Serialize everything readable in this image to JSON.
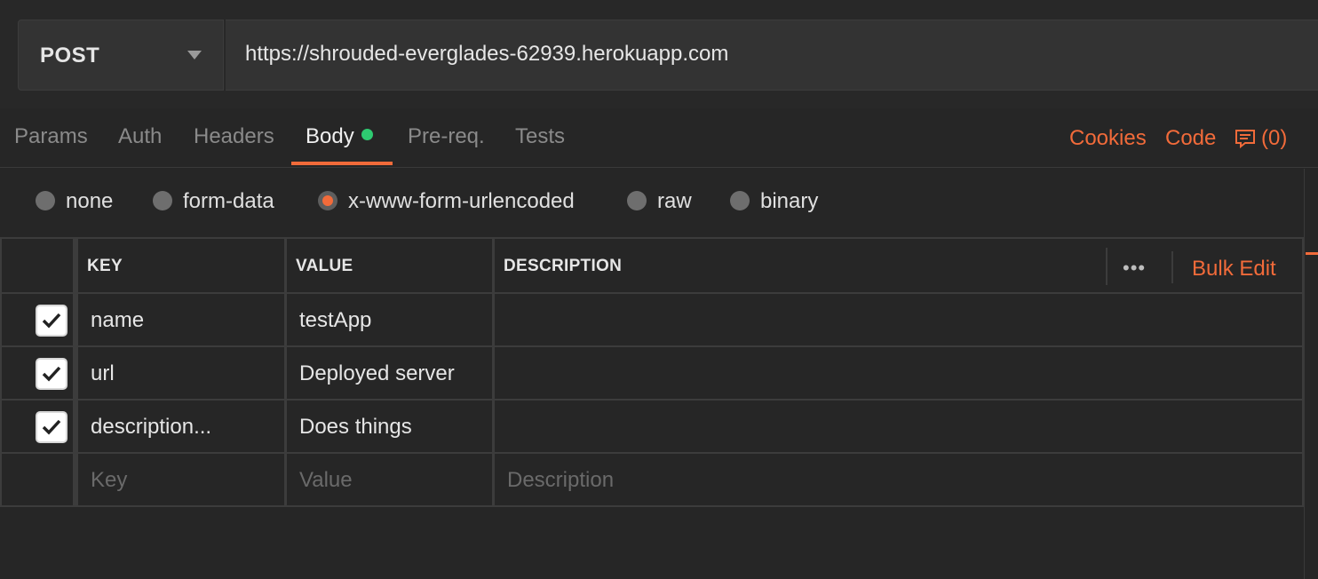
{
  "request": {
    "method": "POST",
    "url": "https://shrouded-everglades-62939.herokuapp.com"
  },
  "tabs": [
    {
      "label": "Params"
    },
    {
      "label": "Auth"
    },
    {
      "label": "Headers"
    },
    {
      "label": "Body"
    },
    {
      "label": "Pre-req."
    },
    {
      "label": "Tests"
    }
  ],
  "active_tab": "Body",
  "right_links": {
    "cookies": "Cookies",
    "code": "Code",
    "comments_count": "(0)"
  },
  "body_types": [
    {
      "label": "none"
    },
    {
      "label": "form-data"
    },
    {
      "label": "x-www-form-urlencoded"
    },
    {
      "label": "raw"
    },
    {
      "label": "binary"
    }
  ],
  "selected_body_type": "x-www-form-urlencoded",
  "table": {
    "headers": {
      "key": "KEY",
      "value": "VALUE",
      "description": "DESCRIPTION"
    },
    "bulk_edit": "Bulk Edit",
    "more": "•••",
    "rows": [
      {
        "checked": true,
        "key": "name",
        "value": "testApp",
        "description": ""
      },
      {
        "checked": true,
        "key": "url",
        "value": "Deployed server",
        "description": ""
      },
      {
        "checked": true,
        "key": "description...",
        "value": "Does things",
        "description": ""
      }
    ],
    "placeholders": {
      "key": "Key",
      "value": "Value",
      "description": "Description"
    }
  },
  "colors": {
    "accent": "#f26b3a",
    "status_dot": "#2ecb71",
    "background": "#262626"
  }
}
